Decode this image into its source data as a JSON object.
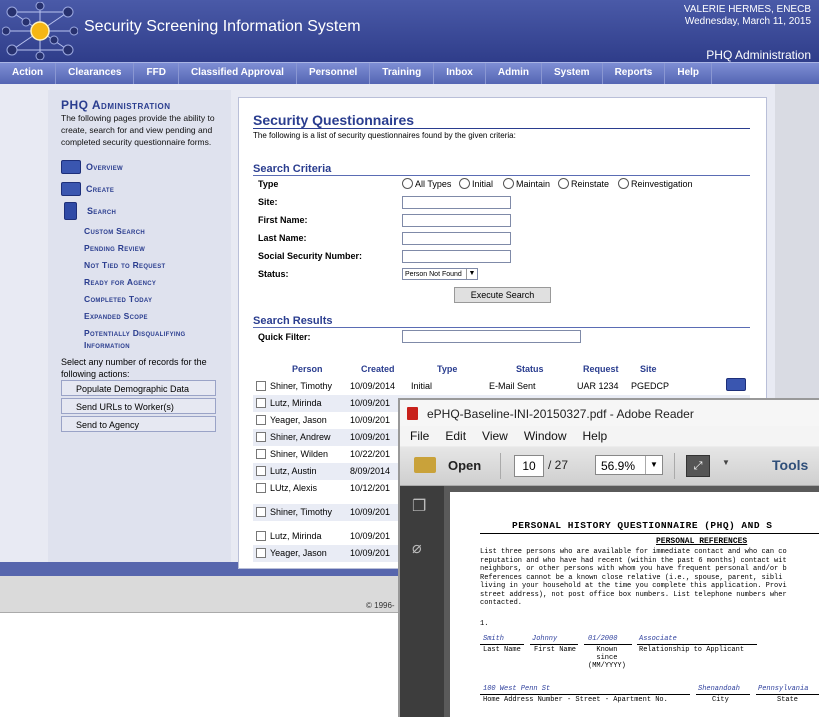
{
  "header": {
    "title": "Security Screening Information System",
    "user_name": "VALERIE HERMES, ENECB",
    "date": "Wednesday, March 11, 2015",
    "section": "PHQ Administration"
  },
  "nav": [
    "Action",
    "Clearances",
    "FFD",
    "Classified Approval",
    "Personnel",
    "Training",
    "Inbox",
    "Admin",
    "System",
    "Reports",
    "Help"
  ],
  "sidebar": {
    "title": "PHQ Administration",
    "description": "The following pages provide the ability to create, search for and view pending and completed security questionnaire forms.",
    "main_items": [
      "Overview",
      "Create",
      "Search"
    ],
    "sub_items": [
      "Custom Search",
      "Pending Review",
      "Not Tied to Request",
      "Ready for Agency",
      "Completed Today",
      "Expanded Scope",
      "Potentially Disqualifying",
      "Information"
    ],
    "select_text": "Select any number of records for the following actions:",
    "actions": [
      "Populate Demographic Data",
      "Send URLs to Worker(s)",
      "Send to Agency"
    ]
  },
  "main": {
    "title": "Security Questionnaires",
    "subtitle": "The following is a list of security questionnaires found by the given criteria:",
    "criteria_title": "Search Criteria",
    "type_label": "Type",
    "type_options": [
      "All Types",
      "Initial",
      "Maintain",
      "Reinstate",
      "Reinvestigation"
    ],
    "field_labels": [
      "Site:",
      "First Name:",
      "Last Name:",
      "Social Security Number:",
      "Status:"
    ],
    "status_value": "Person Not Found",
    "execute_label": "Execute Search",
    "results_title": "Search Results",
    "quick_filter_label": "Quick Filter:",
    "columns": [
      "Person",
      "Created",
      "Type",
      "Status",
      "Request",
      "Site"
    ],
    "rows": [
      {
        "person": "Shiner, Timothy",
        "created": "10/09/2014",
        "type": "Initial",
        "status": "E-Mail Sent",
        "request": "UAR 1234",
        "site": "PGEDCP"
      },
      {
        "person": "Lutz, Mirinda",
        "created": "10/09/201"
      },
      {
        "person": "Yeager, Jason",
        "created": "10/09/201"
      },
      {
        "person": "Shiner, Andrew",
        "created": "10/09/201"
      },
      {
        "person": "Shiner, Wilden",
        "created": "10/22/201"
      },
      {
        "person": "Lutz, Austin",
        "created": "8/09/2014"
      },
      {
        "person": "LUtz, Alexis",
        "created": "10/12/201"
      },
      {
        "person": "Shiner, Timothy",
        "created": "10/09/201"
      },
      {
        "person": "Lutz, Mirinda",
        "created": "10/09/201"
      },
      {
        "person": "Yeager, Jason",
        "created": "10/09/201"
      }
    ],
    "copyright": "© 1996-"
  },
  "adobe": {
    "title": "ePHQ-Baseline-INI-20150327.pdf - Adobe Reader",
    "menu": [
      "File",
      "Edit",
      "View",
      "Window",
      "Help"
    ],
    "open_label": "Open",
    "page": "10",
    "total": "/ 27",
    "zoom": "56.9%",
    "tools_label": "Tools",
    "pdf": {
      "title": "PERSONAL HISTORY QUESTIONNAIRE (PHQ) AND S",
      "section": "PERSONAL REFERENCES",
      "para": "List three persons who are available for immediate contact and who can co\nreputation and who have had recent (within the past 6 months) contact wit\nneighbors, or other persons with whom you have frequent personal and/or b\nReferences cannot be a known close relative (i.e., spouse, parent, sibli\nliving in your household at the time you complete this application. Provi\nstreet address), not post office box numbers. List telephone numbers wher\ncontacted.",
      "item_num": "1.",
      "last_name": "Smith",
      "first_name": "Johnny",
      "known_since": "01/2000",
      "relationship": "Associate",
      "cap_last": "Last Name",
      "cap_first": "First Name",
      "cap_known": "Known\nsince\n(MM/YYYY)",
      "cap_rel": "Relationship to Applicant",
      "address": "100 West Penn St",
      "city": "Shenandoah",
      "state": "Pennsylvania",
      "cap_address": "Home Address Number - Street - Apartment No.",
      "cap_city": "City",
      "cap_state": "State"
    }
  }
}
